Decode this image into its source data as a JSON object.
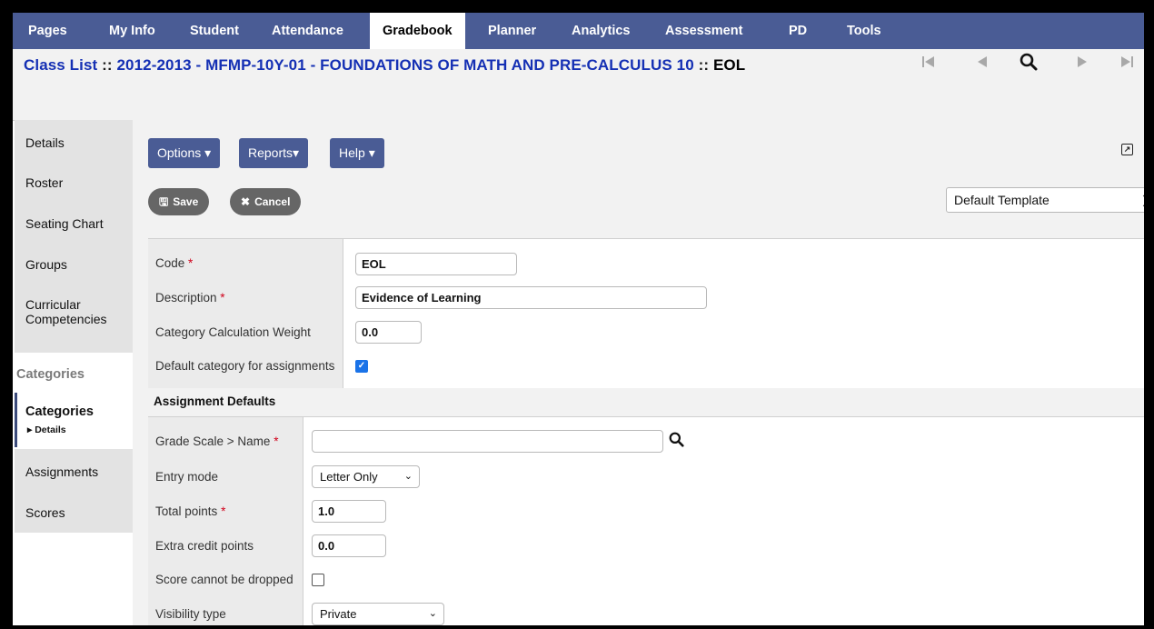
{
  "nav": {
    "items": [
      "Pages",
      "My Info",
      "Student",
      "Attendance",
      "Gradebook",
      "Planner",
      "Analytics",
      "Assessment",
      "PD",
      "Tools"
    ],
    "active": "Gradebook"
  },
  "title": {
    "prefix": "Class List",
    "separator": " :: ",
    "course": "2012-2013 - MFMP-10Y-01 - FOUNDATIONS OF MATH AND PRE-CALCULUS 10",
    "record": "EOL"
  },
  "record_nav": {
    "first": "⏮",
    "prev": "◀",
    "next": "▶",
    "last": "⏭"
  },
  "sidebar": {
    "items": [
      "Details",
      "Roster",
      "Seating Chart",
      "Groups",
      "Curricular Competencies"
    ],
    "section": "Categories",
    "active_label": "Categories",
    "active_sub": "▸ Details",
    "items_after": [
      "Assignments",
      "Scores"
    ]
  },
  "toolbar": {
    "options_label": "Options",
    "reports_label": "Reports",
    "help_label": "Help",
    "save_label": "Save",
    "cancel_label": "Cancel",
    "template_value": "Default Template"
  },
  "form": {
    "code_label": "Code",
    "code_value": "EOL",
    "description_label": "Description",
    "description_value": "Evidence of Learning",
    "weight_label": "Category Calculation Weight",
    "weight_value": "0.0",
    "default_label": "Default category for assignments",
    "default_checked": true
  },
  "assignment_defaults": {
    "heading": "Assignment Defaults",
    "grade_scale_label": "Grade Scale > Name",
    "grade_scale_value": "",
    "entry_mode_label": "Entry mode",
    "entry_mode_value": "Letter Only",
    "total_points_label": "Total points",
    "total_points_value": "1.0",
    "extra_credit_label": "Extra credit points",
    "extra_credit_value": "0.0",
    "drop_label": "Score cannot be dropped",
    "drop_checked": false,
    "visibility_label": "Visibility type",
    "visibility_value": "Private"
  },
  "required_marker": "*"
}
